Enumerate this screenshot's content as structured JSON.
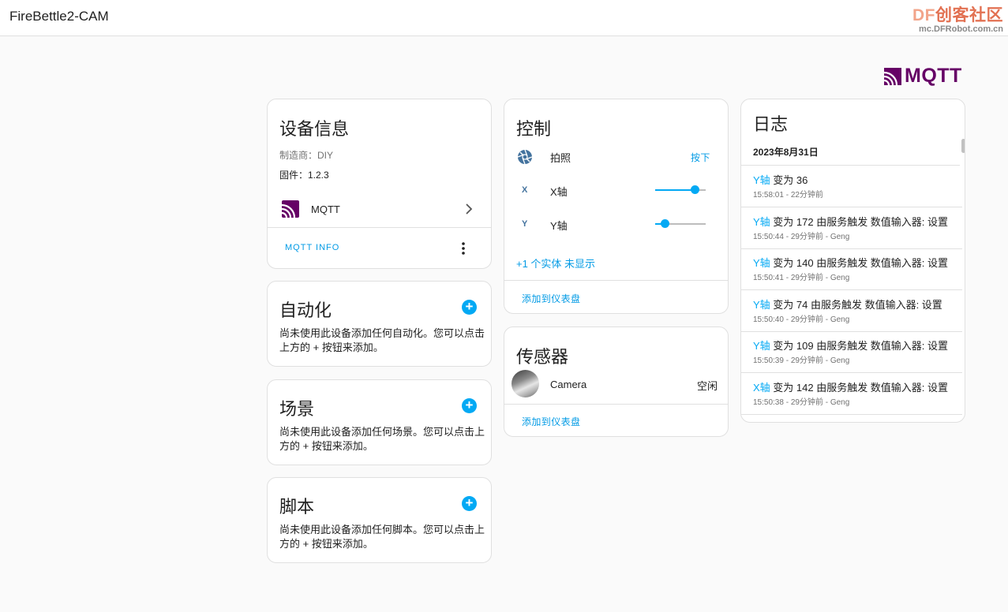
{
  "app": {
    "title": "FireBettle2-CAM"
  },
  "watermark": {
    "df": "DF",
    "cn": "创客社区",
    "url": "mc.DFRobot.com.cn"
  },
  "brand": {
    "name": "MQTT"
  },
  "colors": {
    "accent": "#03a9f4",
    "brand": "#660066",
    "icon": "#44739e"
  },
  "device_info": {
    "title": "设备信息",
    "manufacturer": "制造商：DIY",
    "firmware": "固件：1.2.3",
    "integration_label": "MQTT",
    "info_button": "MQTT INFO"
  },
  "automation": {
    "title": "自动化",
    "description": "尚未使用此设备添加任何自动化。您可以点击上方的 + 按钮来添加。"
  },
  "scene": {
    "title": "场景",
    "description": "尚未使用此设备添加任何场景。您可以点击上方的 + 按钮来添加。"
  },
  "script": {
    "title": "脚本",
    "description": "尚未使用此设备添加任何脚本。您可以点击上方的 + 按钮来添加。"
  },
  "controls": {
    "title": "控制",
    "photo": {
      "label": "拍照",
      "action": "按下",
      "icon": "camera-iris-icon"
    },
    "x_axis": {
      "icon_text": "X",
      "label": "X轴",
      "value_fraction": 0.78
    },
    "y_axis": {
      "icon_text": "Y",
      "label": "Y轴",
      "value_fraction": 0.18
    },
    "hidden_entities": "+1 个实体 未显示",
    "add_to_dashboard": "添加到仪表盘"
  },
  "sensors": {
    "title": "传感器",
    "camera": {
      "label": "Camera",
      "state": "空闲"
    },
    "add_to_dashboard": "添加到仪表盘"
  },
  "log": {
    "title": "日志",
    "date": "2023年8月31日",
    "entries": [
      {
        "entity": "Y轴",
        "text": " 变为 36",
        "time": "15:58:01 - 22分钟前"
      },
      {
        "entity": "Y轴",
        "text": " 变为 172 由服务触发 数值输入器: 设置",
        "time": "15:50:44 - 29分钟前 - Geng"
      },
      {
        "entity": "Y轴",
        "text": " 变为 140 由服务触发 数值输入器: 设置",
        "time": "15:50:41 - 29分钟前 - Geng"
      },
      {
        "entity": "Y轴",
        "text": " 变为 74 由服务触发 数值输入器: 设置",
        "time": "15:50:40 - 29分钟前 - Geng"
      },
      {
        "entity": "Y轴",
        "text": " 变为 109 由服务触发 数值输入器: 设置",
        "time": "15:50:39 - 29分钟前 - Geng"
      },
      {
        "entity": "X轴",
        "text": " 变为 142 由服务触发 数值输入器: 设置",
        "time": "15:50:38 - 29分钟前 - Geng"
      }
    ]
  }
}
